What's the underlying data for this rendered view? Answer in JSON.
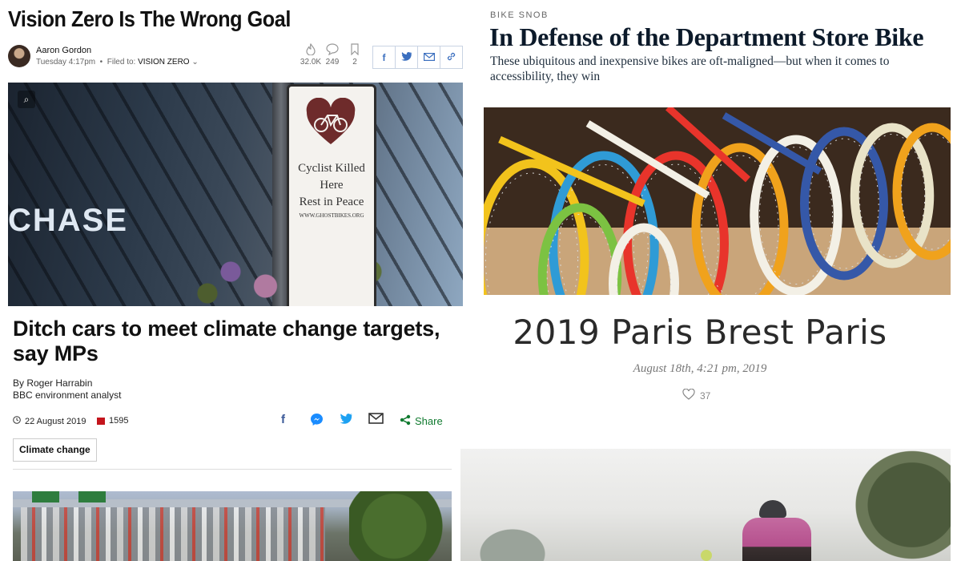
{
  "vision_zero": {
    "title": "Vision Zero Is The Wrong Goal",
    "author": "Aaron Gordon",
    "time": "Tuesday 4:17pm",
    "filed_prefix": "Filed to:",
    "filed_tag": "VISION ZERO",
    "stats": {
      "views": "32.0K",
      "comments": "249",
      "bookmarks": "2"
    },
    "share": [
      "f",
      "t",
      "email",
      "link"
    ],
    "image": {
      "building_text": "CHASE",
      "sign_lines": [
        "Cyclist Killed",
        "Here",
        "Rest in Peace"
      ],
      "sign_small": "WWW.GHOSTBIKES.ORG"
    }
  },
  "bbc": {
    "title": "Ditch cars to meet climate change targets, say MPs",
    "byline": "By Roger Harrabin",
    "role": "BBC environment analyst",
    "date": "22 August 2019",
    "comments": "1595",
    "share_label": "Share",
    "tag": "Climate change",
    "colors": {
      "share": "#107a2f",
      "comment": "#c4151c",
      "facebook": "#3b5998",
      "messenger": "#1a8cff",
      "twitter": "#1da1f2"
    }
  },
  "bike_snob": {
    "kicker": "BIKE SNOB",
    "title": "In Defense of the Department Store Bike",
    "dek": "These ubiquitous and inexpensive bikes are oft-maligned—but when it comes to accessibility, they win",
    "bike_wheel_colors": [
      "#f2c31c",
      "#2f9bd6",
      "#e8342b",
      "#7cc242",
      "#f0a21c",
      "#f3f0e6",
      "#3558a8",
      "#e9e3c8"
    ]
  },
  "paris": {
    "title": "2019 Paris Brest Paris",
    "date": "August 18th, 4:21 pm, 2019",
    "likes": "37"
  }
}
